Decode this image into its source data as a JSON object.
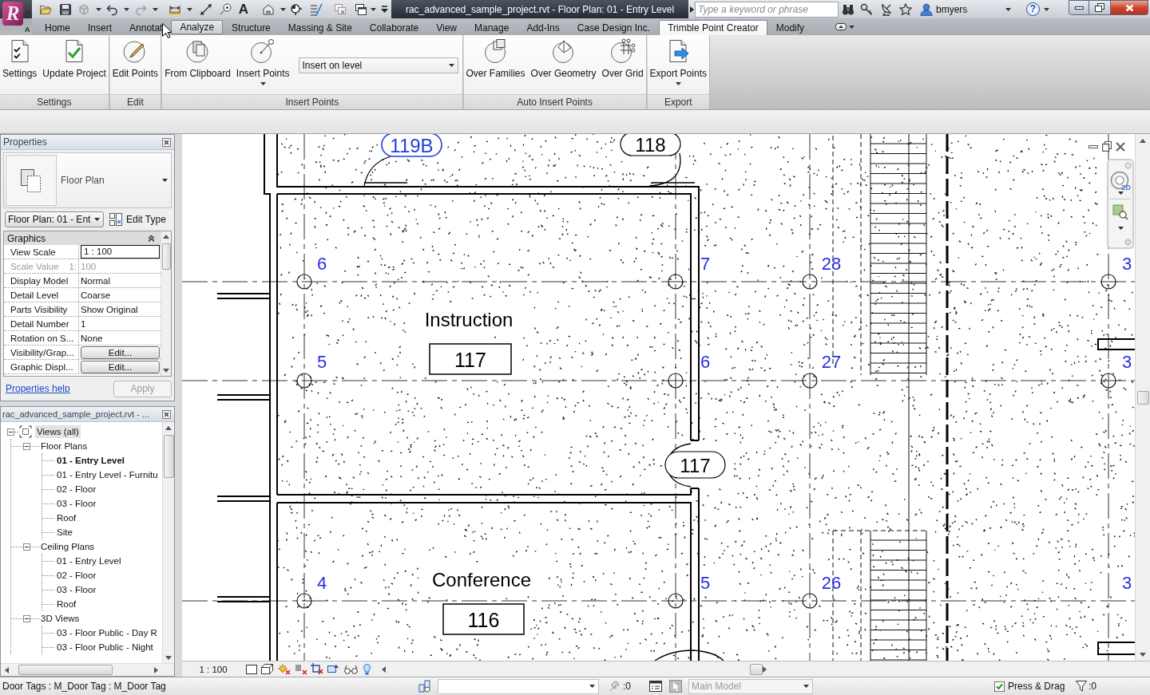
{
  "app_button": {
    "logo": "R",
    "badge": "A"
  },
  "quick_access": {
    "text_tool": "A"
  },
  "title_bar": {
    "title": "rac_advanced_sample_project.rvt - Floor Plan: 01 - Entry Level",
    "search": {
      "placeholder": "Type a keyword or phrase"
    },
    "user": "bmyers",
    "help": "?"
  },
  "ribbon": {
    "tabs": [
      {
        "label": "Home",
        "selected": false,
        "hovered": false
      },
      {
        "label": "Insert",
        "selected": false,
        "hovered": false
      },
      {
        "label": "Annotat",
        "selected": false,
        "hovered": false
      },
      {
        "label": "Analyze",
        "selected": false,
        "hovered": true
      },
      {
        "label": "Structure",
        "selected": false,
        "hovered": false
      },
      {
        "label": "Massing & Site",
        "selected": false,
        "hovered": false
      },
      {
        "label": "Collaborate",
        "selected": false,
        "hovered": false
      },
      {
        "label": "View",
        "selected": false,
        "hovered": false
      },
      {
        "label": "Manage",
        "selected": false,
        "hovered": false
      },
      {
        "label": "Add-Ins",
        "selected": false,
        "hovered": false
      },
      {
        "label": "Case Design Inc.",
        "selected": false,
        "hovered": false
      },
      {
        "label": "Trimble Point Creator",
        "selected": true,
        "hovered": false
      },
      {
        "label": "Modify",
        "selected": false,
        "hovered": false
      }
    ],
    "panels": [
      {
        "title": "Settings",
        "items": [
          {
            "kind": "button",
            "label": "Settings"
          },
          {
            "kind": "button",
            "label": "Update Project"
          }
        ]
      },
      {
        "title": "Edit",
        "items": [
          {
            "kind": "button",
            "label": "Edit Points"
          }
        ]
      },
      {
        "title": "Insert Points",
        "items": [
          {
            "kind": "button",
            "label": "From Clipboard"
          },
          {
            "kind": "split",
            "label": "Insert Points"
          },
          {
            "kind": "combo",
            "value": "Insert on level"
          }
        ]
      },
      {
        "title": "Auto Insert Points",
        "items": [
          {
            "kind": "button",
            "label": "Over Families"
          },
          {
            "kind": "button",
            "label": "Over Geometry"
          },
          {
            "kind": "button",
            "label": "Over Grid"
          }
        ]
      },
      {
        "title": "Export",
        "items": [
          {
            "kind": "split",
            "label": "Export Points"
          }
        ]
      }
    ]
  },
  "properties": {
    "title": "Properties",
    "type_name": "Floor Plan",
    "instance": "Floor Plan: 01 - Ent",
    "edit_type": "Edit Type",
    "group": "Graphics",
    "rows": [
      {
        "name": "View Scale",
        "value": "1 : 100",
        "kind": "field",
        "disabled": false
      },
      {
        "name": "Scale Value",
        "unit": "1:",
        "value": "100",
        "kind": "text",
        "disabled": true
      },
      {
        "name": "Display Model",
        "value": "Normal",
        "kind": "text",
        "disabled": false
      },
      {
        "name": "Detail Level",
        "value": "Coarse",
        "kind": "text",
        "disabled": false
      },
      {
        "name": "Parts Visibility",
        "value": "Show Original",
        "kind": "text",
        "disabled": false
      },
      {
        "name": "Detail Number",
        "value": "1",
        "kind": "text",
        "disabled": false
      },
      {
        "name": "Rotation on S...",
        "value": "None",
        "kind": "text",
        "disabled": false
      },
      {
        "name": "Visibility/Grap...",
        "value": "Edit...",
        "kind": "button",
        "disabled": false
      },
      {
        "name": "Graphic Displ...",
        "value": "Edit...",
        "kind": "button",
        "disabled": false
      }
    ],
    "help_link": "Properties help",
    "apply": {
      "label": "Apply",
      "disabled": true
    }
  },
  "project_browser": {
    "title": "rac_advanced_sample_project.rvt - ...",
    "tree": [
      {
        "label": "Views (all)",
        "expanded": true,
        "selected": true,
        "current": false,
        "children": [
          {
            "label": "Floor Plans",
            "expanded": true,
            "selected": false,
            "current": false,
            "children": [
              {
                "label": "01 - Entry Level",
                "selected": false,
                "current": true
              },
              {
                "label": "01 - Entry Level - Furnitu",
                "selected": false,
                "current": false
              },
              {
                "label": "02 - Floor",
                "selected": false,
                "current": false
              },
              {
                "label": "03 - Floor",
                "selected": false,
                "current": false
              },
              {
                "label": "Roof",
                "selected": false,
                "current": false
              },
              {
                "label": "Site",
                "selected": false,
                "current": false
              }
            ]
          },
          {
            "label": "Ceiling Plans",
            "expanded": true,
            "selected": false,
            "current": false,
            "children": [
              {
                "label": "01 - Entry Level",
                "selected": false,
                "current": false
              },
              {
                "label": "02 - Floor",
                "selected": false,
                "current": false
              },
              {
                "label": "03 - Floor",
                "selected": false,
                "current": false
              },
              {
                "label": "Roof",
                "selected": false,
                "current": false
              }
            ]
          },
          {
            "label": "3D Views",
            "expanded": true,
            "selected": false,
            "current": false,
            "children": [
              {
                "label": "03 - Floor Public - Day R",
                "selected": false,
                "current": false
              },
              {
                "label": "03 - Floor Public - Night",
                "selected": false,
                "current": false
              }
            ]
          }
        ]
      }
    ]
  },
  "view": {
    "door_tags": [
      {
        "label": "119B",
        "selected": true
      },
      {
        "label": "118",
        "selected": false
      },
      {
        "label": "117",
        "selected": false
      }
    ],
    "point_labels": [
      "6",
      "7",
      "28",
      "3",
      "5",
      "6",
      "27",
      "3",
      "4",
      "5",
      "26",
      "3"
    ],
    "rooms": [
      {
        "name": "Instruction",
        "number": "117"
      },
      {
        "name": "Conference",
        "number": "116"
      }
    ],
    "nav_wheel": "2D",
    "scale": "1 : 100"
  },
  "status_bar": {
    "message": "Door Tags : M_Door Tag : M_Door Tag",
    "editable_count": ":0",
    "design_option": {
      "value": "Main Model",
      "disabled": true
    },
    "press_drag": {
      "label": "Press & Drag",
      "checked": true
    },
    "filter_count": ":0"
  }
}
